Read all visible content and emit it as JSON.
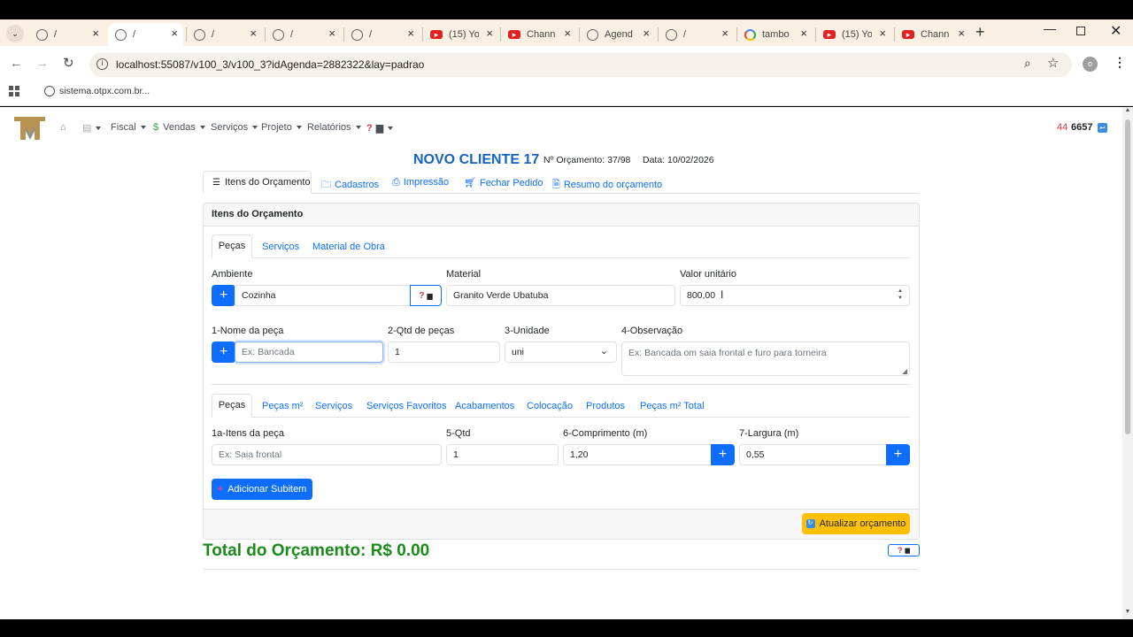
{
  "browser": {
    "tabs": [
      {
        "title": "/",
        "icon": "globe"
      },
      {
        "title": "/",
        "icon": "globe"
      },
      {
        "title": "/",
        "icon": "globe"
      },
      {
        "title": "/",
        "icon": "globe"
      },
      {
        "title": "/",
        "icon": "globe"
      },
      {
        "title": "(15) Yo",
        "icon": "youtube"
      },
      {
        "title": "Chann",
        "icon": "youtube"
      },
      {
        "title": "Agend",
        "icon": "globe"
      },
      {
        "title": "/",
        "icon": "globe"
      },
      {
        "title": "tambo",
        "icon": "google"
      },
      {
        "title": "(15) Yo",
        "icon": "youtube"
      },
      {
        "title": "Chann",
        "icon": "youtube"
      }
    ],
    "url": "localhost:55087/v100_3/v100_3?idAgenda=2882322&lay=padrao",
    "bookmark": "sistema.otpx.com.br...",
    "profile_initial": "o"
  },
  "nav": {
    "items": [
      "Fiscal",
      "Vendas",
      "Serviços",
      "Projeto",
      "Relatórios"
    ],
    "counter_red": "44",
    "counter": "6657"
  },
  "header": {
    "client": "NOVO CLIENTE 17",
    "orcamento_label": "Nº Orçamento:",
    "orcamento_value": "37/98",
    "data_label": "Data:",
    "data_value": "10/02/2026"
  },
  "tabs": [
    "Itens do Orçamento",
    "Cadastros",
    "Impressão",
    "Fechar Pedido",
    "Resumo do orçamento"
  ],
  "card": {
    "title": "Itens do Orçamento",
    "subtabs": [
      "Peças",
      "Serviços",
      "Material de Obra"
    ],
    "ambiente_label": "Ambiente",
    "ambiente_value": "Cozinha",
    "material_label": "Material",
    "material_value": "Granito Verde Ubatuba",
    "valor_label": "Valor unitário",
    "valor_value": "800,00",
    "nome_label": "1-Nome da peça",
    "nome_placeholder": "Ex: Bancada",
    "qtd_label": "2-Qtd de peças",
    "qtd_value": "1",
    "unidade_label": "3-Unidade",
    "unidade_value": "uni",
    "obs_label": "4-Observação",
    "obs_placeholder": "Ex: Bancada om saia frontal e furo para torneira",
    "itemtabs": [
      "Peças",
      "Peças m²",
      "Serviços",
      "Serviços Favoritos",
      "Acabamentos",
      "Colocação",
      "Produtos",
      "Peças m² Total"
    ],
    "item_label": "1a-Itens da peça",
    "item_placeholder": "Ex: Saia frontal",
    "sqtd_label": "5-Qtd",
    "sqtd_value": "1",
    "comp_label": "6-Comprimento (m)",
    "comp_value": "1,20",
    "larg_label": "7-Largura (m)",
    "larg_value": "0,55",
    "add_sub": "Adicionar Subitem",
    "update": "Atualizar orçamento"
  },
  "total": "Total do Orçamento: R$ 0.00"
}
